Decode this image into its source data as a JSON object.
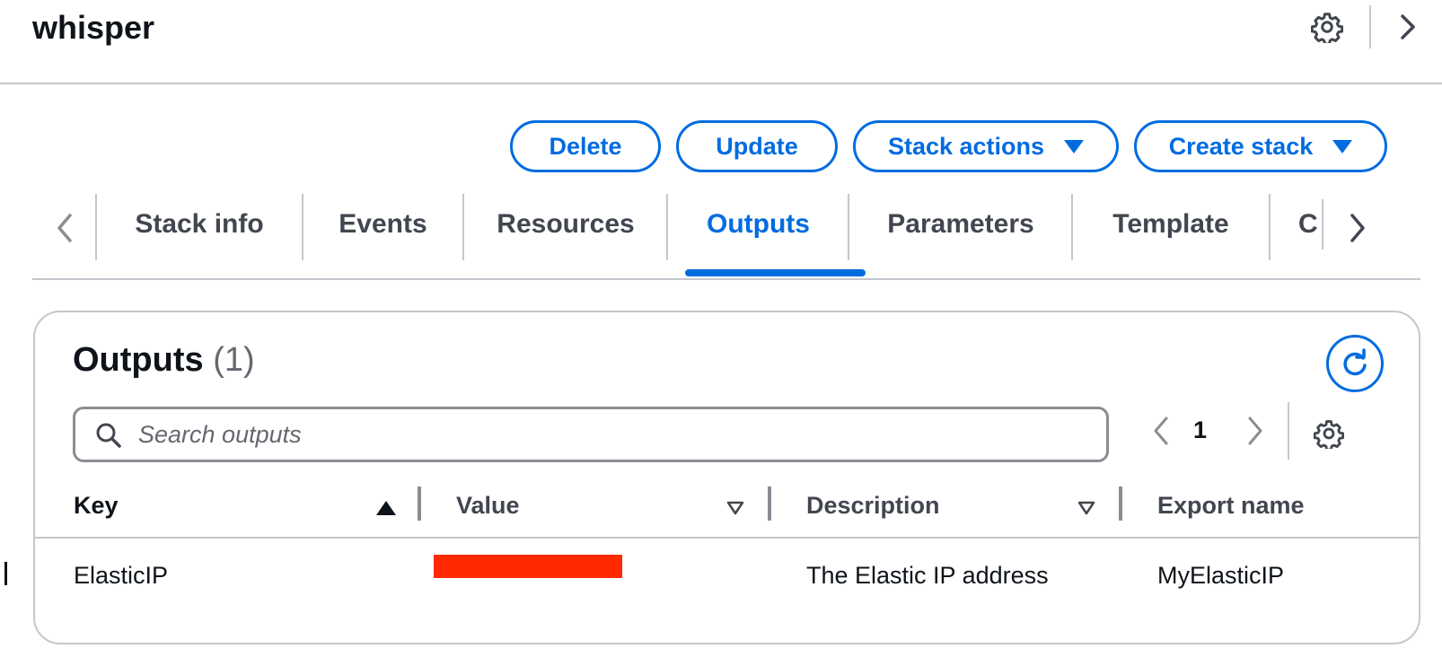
{
  "header": {
    "title": "whisper",
    "settings_icon": "gear-icon",
    "collapse_icon": "chevron-right-icon"
  },
  "actions": {
    "delete": "Delete",
    "update": "Update",
    "stack_actions": "Stack actions",
    "create_stack": "Create stack"
  },
  "tabs": [
    {
      "label": "Stack info",
      "active": false
    },
    {
      "label": "Events",
      "active": false
    },
    {
      "label": "Resources",
      "active": false
    },
    {
      "label": "Outputs",
      "active": true
    },
    {
      "label": "Parameters",
      "active": false
    },
    {
      "label": "Template",
      "active": false
    },
    {
      "label": "C",
      "active": false
    }
  ],
  "outputs": {
    "title": "Outputs",
    "count": "(1)",
    "search_placeholder": "Search outputs",
    "page": "1",
    "columns": [
      "Key",
      "Value",
      "Description",
      "Export name"
    ],
    "rows": [
      {
        "key": "ElasticIP",
        "value": "",
        "description": "The Elastic IP address",
        "export_name": "MyElasticIP"
      }
    ]
  },
  "colors": {
    "accent": "#006ce0",
    "redaction": "#ff2a00",
    "text": "#0f141a",
    "muted": "#424650",
    "border": "#c6c6cd"
  }
}
